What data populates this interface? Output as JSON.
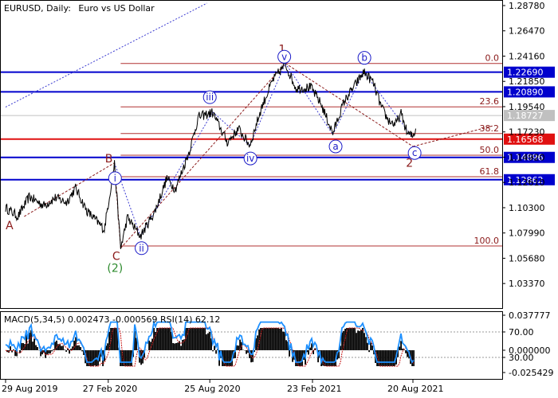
{
  "header": {
    "symbol": "EURUSD",
    "timeframe": "Daily",
    "description": "Euro vs US Dollar"
  },
  "chart_data": {
    "type": "line",
    "main_panel": {
      "ylim": [
        1.02,
        1.2878
      ],
      "tick_labels": [
        "1.28780",
        "1.26470",
        "1.24160",
        "1.21850",
        "1.19540",
        "1.17230",
        "1.14920",
        "1.12610",
        "1.10300",
        "1.07990",
        "1.05680",
        "1.03370"
      ],
      "tick_values": [
        1.2878,
        1.2647,
        1.2416,
        1.2185,
        1.1954,
        1.1723,
        1.1492,
        1.1261,
        1.103,
        1.0799,
        1.0568,
        1.0337
      ],
      "price_series": [
        [
          "2019-08-29",
          1.103
        ],
        [
          "2019-09-20",
          1.095
        ],
        [
          "2019-10-10",
          1.113
        ],
        [
          "2019-11-05",
          1.105
        ],
        [
          "2019-11-25",
          1.112
        ],
        [
          "2019-12-15",
          1.108
        ],
        [
          "2019-12-31",
          1.121
        ],
        [
          "2020-01-20",
          1.1
        ],
        [
          "2020-02-08",
          1.09
        ],
        [
          "2020-02-20",
          1.083
        ],
        [
          "2020-03-09",
          1.143
        ],
        [
          "2020-03-20",
          1.066
        ],
        [
          "2020-04-01",
          1.094
        ],
        [
          "2020-04-24",
          1.077
        ],
        [
          "2020-05-20",
          1.1
        ],
        [
          "2020-06-10",
          1.13
        ],
        [
          "2020-06-25",
          1.12
        ],
        [
          "2020-07-20",
          1.155
        ],
        [
          "2020-08-05",
          1.186
        ],
        [
          "2020-08-30",
          1.19
        ],
        [
          "2020-09-25",
          1.163
        ],
        [
          "2020-10-15",
          1.175
        ],
        [
          "2020-11-04",
          1.16
        ],
        [
          "2020-11-25",
          1.195
        ],
        [
          "2020-12-15",
          1.22
        ],
        [
          "2021-01-06",
          1.234
        ],
        [
          "2021-01-25",
          1.212
        ],
        [
          "2021-02-20",
          1.213
        ],
        [
          "2021-03-10",
          1.198
        ],
        [
          "2021-03-31",
          1.171
        ],
        [
          "2021-04-20",
          1.2
        ],
        [
          "2021-05-25",
          1.227
        ],
        [
          "2021-06-10",
          1.218
        ],
        [
          "2021-06-25",
          1.195
        ],
        [
          "2021-07-07",
          1.183
        ],
        [
          "2021-07-20",
          1.179
        ],
        [
          "2021-07-30",
          1.189
        ],
        [
          "2021-08-10",
          1.171
        ],
        [
          "2021-08-20",
          1.168
        ],
        [
          "2021-08-25",
          1.1753
        ]
      ],
      "levels": [
        {
          "price": 1.2269,
          "label": "1.22690",
          "color": "#0000cd"
        },
        {
          "price": 1.2089,
          "label": "1.20890",
          "color": "#0000cd"
        },
        {
          "price": 1.1873,
          "label": "1.18727",
          "color": "#c0c0c0"
        },
        {
          "price": 1.1657,
          "label": "1.16568",
          "color": "#e01010"
        },
        {
          "price": 1.149,
          "label": "1.14896",
          "color": "#0000cd"
        },
        {
          "price": 1.1286,
          "label": "1.12862",
          "color": "#0000cd"
        }
      ],
      "fibonacci": [
        {
          "label": "0.0",
          "price": 1.2349
        },
        {
          "label": "23.6",
          "price": 1.1952
        },
        {
          "label": "38.2",
          "price": 1.1708
        },
        {
          "label": "50.0",
          "price": 1.151
        },
        {
          "label": "61.8",
          "price": 1.1313
        },
        {
          "label": "100.0",
          "price": 1.068
        }
      ],
      "wave_labels": {
        "plain": [
          "A",
          "B",
          "C",
          "1",
          "2"
        ],
        "green": [
          "(2)"
        ],
        "circled": [
          "i",
          "ii",
          "iii",
          "iv",
          "v",
          "a",
          "b",
          "c"
        ]
      }
    },
    "indicator_panel": {
      "title": "MACD(5,34,5) 0.002473 -0.000569 RSI(14) 62.12",
      "right_labels": [
        "0.037777",
        "70.00",
        "0.000000",
        "30.00",
        "-0.025429"
      ]
    },
    "x_tick_labels": [
      "29 Aug 2019",
      "27 Feb 2020",
      "25 Aug 2020",
      "23 Feb 2021",
      "20 Aug 2021"
    ]
  },
  "colors": {
    "grid_frame": "#000000",
    "wave_line": "#8b1a1a",
    "circle_label": "#1c1cc8",
    "rsi_line": "#1e90ff",
    "macd_hist": "#000000",
    "macd_signal": "#c81e1e"
  }
}
